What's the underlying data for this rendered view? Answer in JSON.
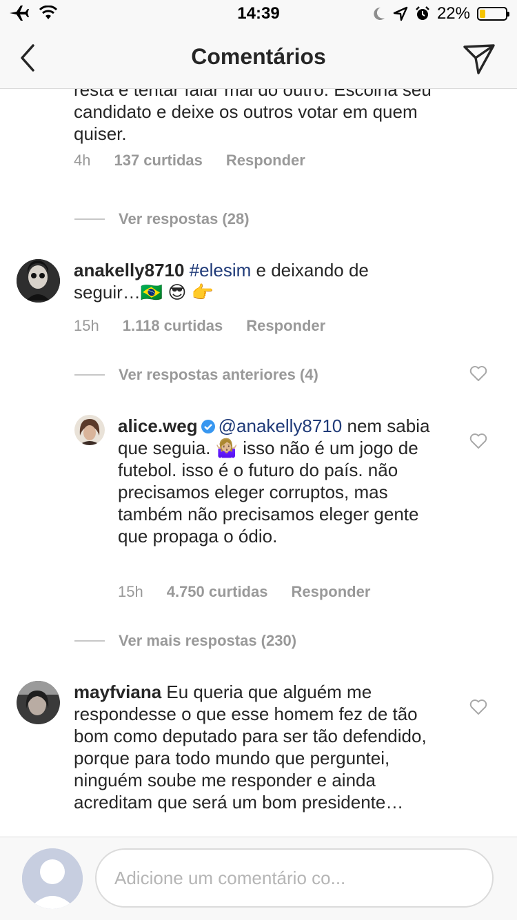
{
  "status_bar": {
    "time": "14:39",
    "battery_percent": "22%",
    "battery_level": 0.22
  },
  "nav": {
    "title": "Comentários"
  },
  "comments": [
    {
      "text": "resta e tentar falar mal do outro. Escolha seu candidato e deixe os outros votar em quem quiser.",
      "time": "4h",
      "likes": "137 curtidas",
      "reply": "Responder",
      "view_replies": "Ver respostas (28)"
    },
    {
      "username": "anakelly8710",
      "hashtag": "#elesim",
      "text": " e deixando de seguir…🇧🇷 😎 👉",
      "time": "15h",
      "likes": "1.118 curtidas",
      "reply": "Responder",
      "view_replies": "Ver respostas anteriores (4)"
    },
    {
      "username": "alice.weg",
      "mention": "@anakelly8710",
      "text": " nem sabia que seguia. 🤷🏼‍♀️ isso não é um jogo de futebol. isso é o futuro do país. não precisamos eleger corruptos, mas também não precisamos eleger gente que propaga o ódio.",
      "time": "15h",
      "likes": "4.750 curtidas",
      "reply": "Responder",
      "view_replies": "Ver mais respostas (230)"
    },
    {
      "username": "mayfviana",
      "text": " Eu queria que alguém me respondesse o que esse homem fez de tão bom como deputado para ser tão defendido, porque para todo mundo que perguntei, ninguém soube me responder e ainda acreditam que será um bom presidente…"
    }
  ],
  "input": {
    "placeholder": "Adicione um comentário co..."
  },
  "icons": {
    "airplane": "airplane-icon",
    "wifi": "wifi-icon",
    "moon": "moon-icon",
    "location": "location-arrow-icon",
    "alarm": "alarm-icon",
    "back": "chevron-left-icon",
    "send": "paper-plane-icon",
    "heart": "heart-outline-icon",
    "verified": "verified-badge-icon"
  },
  "colors": {
    "hashtag": "#1f3a78",
    "verified": "#3897f0",
    "meta": "#999999",
    "battery": "#f5c400"
  }
}
